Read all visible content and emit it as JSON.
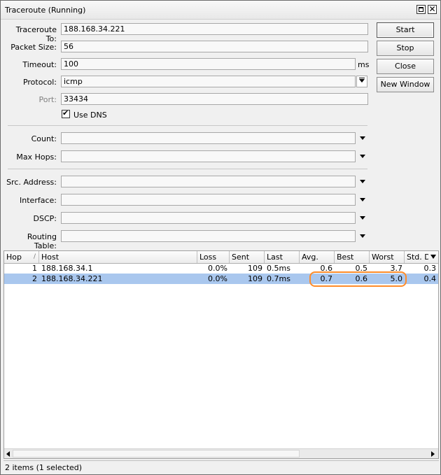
{
  "window": {
    "title": "Traceroute (Running)"
  },
  "form": {
    "traceroute_to": {
      "label": "Traceroute To:",
      "value": "188.168.34.221"
    },
    "packet_size": {
      "label": "Packet Size:",
      "value": "56"
    },
    "timeout": {
      "label": "Timeout:",
      "value": "100",
      "unit": "ms"
    },
    "protocol": {
      "label": "Protocol:",
      "value": "icmp"
    },
    "port": {
      "label": "Port:",
      "value": "33434"
    },
    "use_dns": {
      "label": "Use DNS",
      "checked": true
    },
    "count": {
      "label": "Count:",
      "value": ""
    },
    "max_hops": {
      "label": "Max Hops:",
      "value": ""
    },
    "src_address": {
      "label": "Src. Address:",
      "value": ""
    },
    "interface": {
      "label": "Interface:",
      "value": ""
    },
    "dscp": {
      "label": "DSCP:",
      "value": ""
    },
    "routing_table": {
      "label": "Routing Table:",
      "value": ""
    }
  },
  "buttons": {
    "start": "Start",
    "stop": "Stop",
    "close": "Close",
    "new_window": "New Window"
  },
  "table": {
    "columns": [
      "Hop",
      "Host",
      "Loss",
      "Sent",
      "Last",
      "Avg.",
      "Best",
      "Worst",
      "Std. Dev."
    ],
    "rows": [
      {
        "hop": "1",
        "host": "188.168.34.1",
        "loss": "0.0%",
        "sent": "109",
        "last": "0.5ms",
        "avg": "0.6",
        "best": "0.5",
        "worst": "3.7",
        "std": "0.3"
      },
      {
        "hop": "2",
        "host": "188.168.34.221",
        "loss": "0.0%",
        "sent": "109",
        "last": "0.7ms",
        "avg": "0.7",
        "best": "0.6",
        "worst": "5.0",
        "std": "0.4"
      }
    ]
  },
  "status": "2 items (1 selected)",
  "colors": {
    "selection": "#a9c7ee",
    "highlight": "#ff8c2a"
  }
}
